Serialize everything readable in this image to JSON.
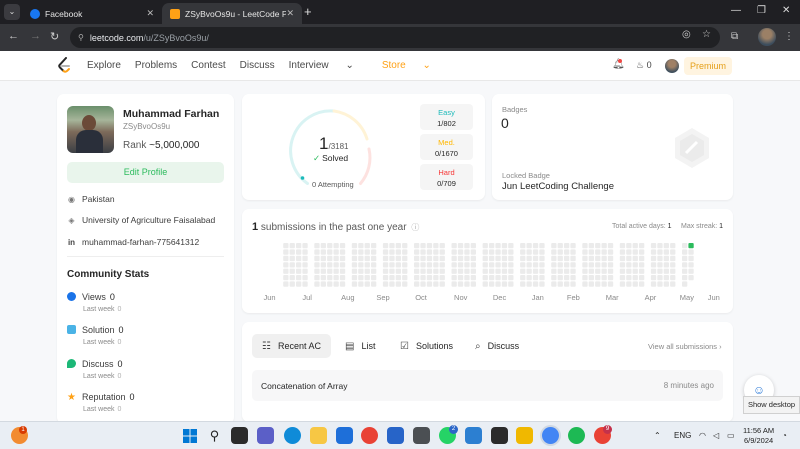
{
  "browser": {
    "tabs": [
      {
        "title": "Facebook",
        "favicon": "facebook-icon"
      },
      {
        "title": "ZSyBvoOs9u - LeetCode Profile",
        "favicon": "leetcode-icon"
      }
    ],
    "url_host": "leetcode.com",
    "url_path": "/u/ZSyBvoOs9u/"
  },
  "nav": {
    "links": [
      "Explore",
      "Problems",
      "Contest",
      "Discuss",
      "Interview",
      "Store"
    ],
    "streak_count": "0",
    "premium_label": "Premium"
  },
  "profile": {
    "name": "Muhammad Farhan",
    "username": "ZSyBvoOs9u",
    "rank_label": "Rank",
    "rank_value": "~5,000,000",
    "edit_label": "Edit Profile",
    "location": "Pakistan",
    "university": "University of Agriculture Faisalabad",
    "linkedin": "muhammad-farhan-775641312"
  },
  "community": {
    "title": "Community Stats",
    "items": [
      {
        "label": "Views",
        "value": "0",
        "sub_label": "Last week",
        "sub_value": "0",
        "color": "#1a73e8"
      },
      {
        "label": "Solution",
        "value": "0",
        "sub_label": "Last week",
        "sub_value": "0",
        "color": "#4ab3e6"
      },
      {
        "label": "Discuss",
        "value": "0",
        "sub_label": "Last week",
        "sub_value": "0",
        "color": "#1cb877"
      },
      {
        "label": "Reputation",
        "value": "0",
        "sub_label": "Last week",
        "sub_value": "0",
        "color": "#ffa116"
      }
    ]
  },
  "solved": {
    "count": "1",
    "total": "/3181",
    "label": "Solved",
    "attempting": "0 Attempting",
    "difficulties": [
      {
        "name": "Easy",
        "count": "1/802",
        "color": "#1cbaba"
      },
      {
        "name": "Med.",
        "count": "0/1670",
        "color": "#ffb700"
      },
      {
        "name": "Hard",
        "count": "0/709",
        "color": "#f63737"
      }
    ]
  },
  "badges": {
    "label": "Badges",
    "count": "0",
    "locked_label": "Locked Badge",
    "locked_name": "Jun LeetCoding Challenge"
  },
  "calendar": {
    "count": "1",
    "text": "submissions in the past one year",
    "total_active_label": "Total active days:",
    "total_active_value": "1",
    "max_streak_label": "Max streak:",
    "max_streak_value": "1",
    "months": [
      "Jun",
      "Jul",
      "Aug",
      "Sep",
      "Oct",
      "Nov",
      "Dec",
      "Jan",
      "Feb",
      "Mar",
      "Apr",
      "May",
      "Jun"
    ],
    "active_color": "#2cbb5d",
    "empty_color": "#ebebeb"
  },
  "recent": {
    "tabs": [
      "Recent AC",
      "List",
      "Solutions",
      "Discuss"
    ],
    "view_all": "View all submissions",
    "items": [
      {
        "title": "Concatenation of Array",
        "time": "8 minutes ago"
      }
    ]
  },
  "desktop": {
    "show_desktop": "Show desktop",
    "language": "ENG",
    "time": "11:56 AM",
    "date": "6/9/2024",
    "notification_badge": "1",
    "whatsapp_badge": "2",
    "notif_badge2": "9"
  }
}
